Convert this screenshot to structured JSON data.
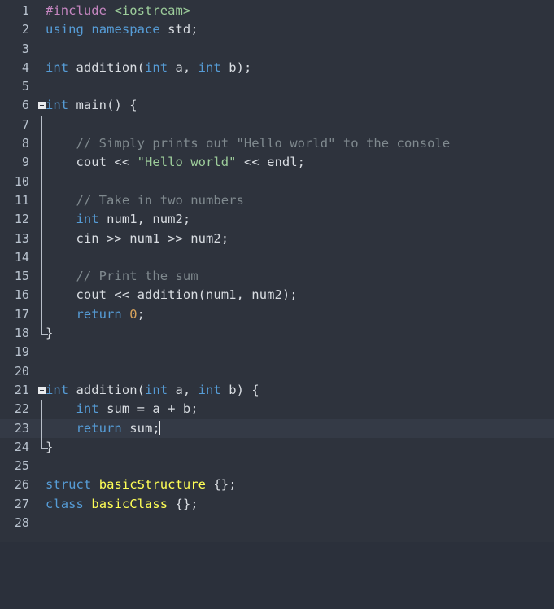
{
  "editor": {
    "language": "cpp",
    "background_color": "#2e333d",
    "current_line_color": "#343a46",
    "gutter_color": "#b9c3cf",
    "cursor_line": 23,
    "cursor_column": 20,
    "total_lines": 28,
    "colors": {
      "keyword": "#569cd6",
      "preprocessor": "#c586c0",
      "string": "#9dcd9b",
      "comment": "#808a8f",
      "number": "#d8a35c",
      "type": "#ffff55",
      "plain": "#d9dde2"
    }
  },
  "lines": [
    {
      "n": "1",
      "text": "#include <iostream>"
    },
    {
      "n": "2",
      "text": "using namespace std;"
    },
    {
      "n": "3",
      "text": ""
    },
    {
      "n": "4",
      "text": "int addition(int a, int b);"
    },
    {
      "n": "5",
      "text": ""
    },
    {
      "n": "6",
      "text": "int main() {"
    },
    {
      "n": "7",
      "text": ""
    },
    {
      "n": "8",
      "text": "    // Simply prints out \"Hello world\" to the console"
    },
    {
      "n": "9",
      "text": "    cout << \"Hello world\" << endl;"
    },
    {
      "n": "10",
      "text": ""
    },
    {
      "n": "11",
      "text": "    // Take in two numbers"
    },
    {
      "n": "12",
      "text": "    int num1, num2;"
    },
    {
      "n": "13",
      "text": "    cin >> num1 >> num2;"
    },
    {
      "n": "14",
      "text": ""
    },
    {
      "n": "15",
      "text": "    // Print the sum"
    },
    {
      "n": "16",
      "text": "    cout << addition(num1, num2);"
    },
    {
      "n": "17",
      "text": "    return 0;"
    },
    {
      "n": "18",
      "text": "}"
    },
    {
      "n": "19",
      "text": ""
    },
    {
      "n": "20",
      "text": ""
    },
    {
      "n": "21",
      "text": "int addition(int a, int b) {"
    },
    {
      "n": "22",
      "text": "    int sum = a + b;"
    },
    {
      "n": "23",
      "text": "    return sum;"
    },
    {
      "n": "24",
      "text": "}"
    },
    {
      "n": "25",
      "text": ""
    },
    {
      "n": "26",
      "text": "struct basicStructure {};"
    },
    {
      "n": "27",
      "text": "class basicClass {};"
    },
    {
      "n": "28",
      "text": ""
    }
  ],
  "tokens": {
    "l1_include": "#include",
    "l1_header": "<iostream>",
    "l2_using": "using",
    "l2_namespace": "namespace",
    "l2_std": "std;",
    "l4_int1": "int",
    "l4_name": " addition(",
    "l4_int2": "int",
    "l4_a": " a, ",
    "l4_int3": "int",
    "l4_b": " b);",
    "l6_int": "int",
    "l6_main": " main() {",
    "l8_comment": "    // Simply prints out \"Hello world\" to the console",
    "l9_cout": "    cout << ",
    "l9_string": "\"Hello world\"",
    "l9_endl": " << endl;",
    "l11_comment": "    // Take in two numbers",
    "l12_int": "    int",
    "l12_rest": " num1, num2;",
    "l13_rest": "    cin >> num1 >> num2;",
    "l15_comment": "    // Print the sum",
    "l16_rest": "    cout << addition(num1, num2);",
    "l17_return": "    return",
    "l17_zero": "0",
    "l17_semi": ";",
    "l18_brace": "}",
    "l21_int1": "int",
    "l21_name": " addition(",
    "l21_int2": "int",
    "l21_a": " a, ",
    "l21_int3": "int",
    "l21_b": " b) {",
    "l22_int": "    int",
    "l22_rest": " sum = a + b;",
    "l23_return": "    return",
    "l23_sum": " sum;",
    "l24_brace": "}",
    "l26_struct": "struct",
    "l26_name": "basicStructure",
    "l26_braces": " {};",
    "l27_class": "class",
    "l27_name": "basicClass",
    "l27_braces": " {};"
  }
}
